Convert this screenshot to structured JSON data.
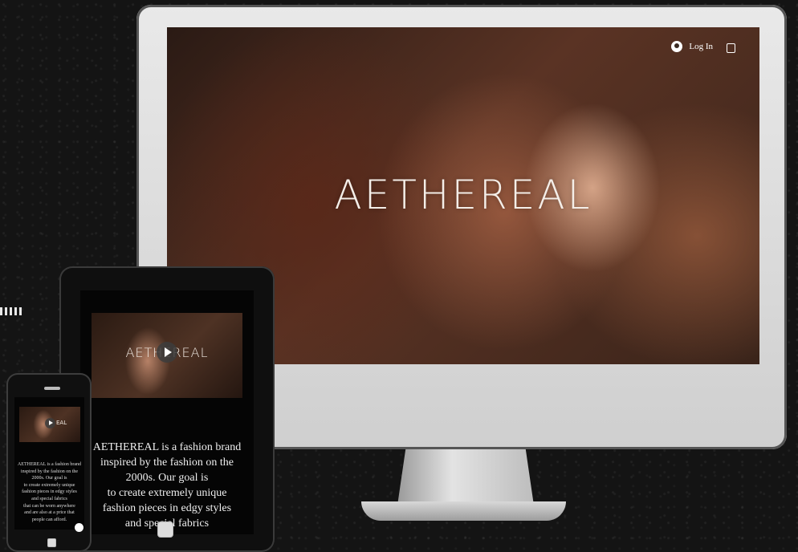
{
  "brand": "AETHEREAL",
  "desktop": {
    "nav": {
      "login_label": "Log In"
    },
    "hero": {
      "title": "AETHEREAL"
    }
  },
  "tablet": {
    "video": {
      "watermark": "AETHEREAL"
    },
    "about": {
      "lines": [
        "AETHEREAL is a fashion brand",
        "inspired by the fashion on the",
        "2000s. Our goal is",
        "to create extremely unique",
        "fashion pieces in edgy styles",
        "and special fabrics"
      ]
    }
  },
  "phone": {
    "video": {
      "watermark": "EAL"
    },
    "about": {
      "lines": [
        "AETHEREAL is a fashion brand",
        "inspired by the fashion on the",
        "2000s. Our goal is",
        "to create extremely unique",
        "fashion pieces in edgy styles",
        "and special fabrics",
        "that can be worn anywhere",
        "and are also at a price that",
        "people can afford."
      ]
    }
  },
  "icons": [
    "user-icon",
    "shopping-bag-icon",
    "play-icon",
    "chat-icon"
  ]
}
